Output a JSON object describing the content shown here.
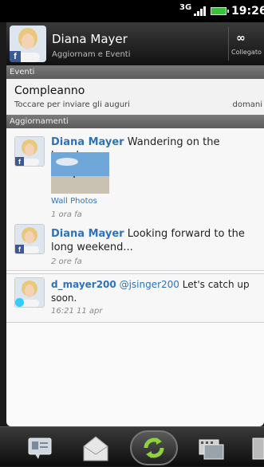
{
  "statusbar": {
    "network": "3G",
    "time": "19:26"
  },
  "contact": {
    "name": "Diana Mayer",
    "subtitle": "Aggiornam e Eventi",
    "link_label": "Collegato"
  },
  "events_header": "Eventi",
  "event": {
    "title": "Compleanno",
    "description": "Toccare per inviare gli auguri",
    "date": "domani"
  },
  "updates_header": "Aggiornamenti",
  "posts": [
    {
      "author": "Diana Mayer",
      "text": "Wandering on the beach...",
      "album": "Wall Photos",
      "time": "1 ora fa",
      "source": "facebook"
    },
    {
      "author": "Diana Mayer",
      "text": "Looking forward to the long weekend...",
      "time": "2 ore fa",
      "source": "facebook"
    },
    {
      "author": "d_mayer200",
      "mention": "@jsinger200",
      "text": "Let's catch up soon.",
      "time": "16:21 11 apr",
      "source": "twitter"
    }
  ],
  "colors": {
    "link_blue": "#2e73b8",
    "facebook": "#3b5998",
    "battery": "#36c23a"
  }
}
